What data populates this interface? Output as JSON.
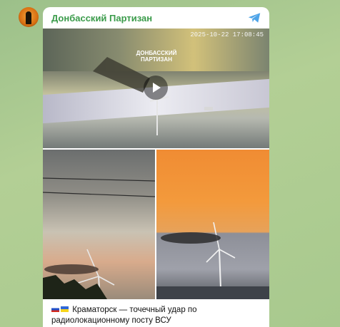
{
  "channel": {
    "name": "Донбасский Партизан",
    "avatar_icon": "partisan-avatar",
    "accent_color": "#3a9b4a"
  },
  "message": {
    "share_icon": "telegram-send-icon",
    "media": [
      {
        "kind": "video",
        "timestamp_overlay": "2025-10-22 17:08:45",
        "watermark": "ДОНБАССКИЙ ПАРТИЗАН",
        "play_icon": "play-icon"
      },
      {
        "kind": "photo",
        "subject": "wind-turbine-smoke-left"
      },
      {
        "kind": "photo",
        "subject": "wind-turbine-smoke-right"
      }
    ],
    "caption": {
      "flags": [
        "russia-flag",
        "ukraine-flag"
      ],
      "text": "Краматорск — точечный удар по радиолокационному посту ВСУ"
    }
  }
}
